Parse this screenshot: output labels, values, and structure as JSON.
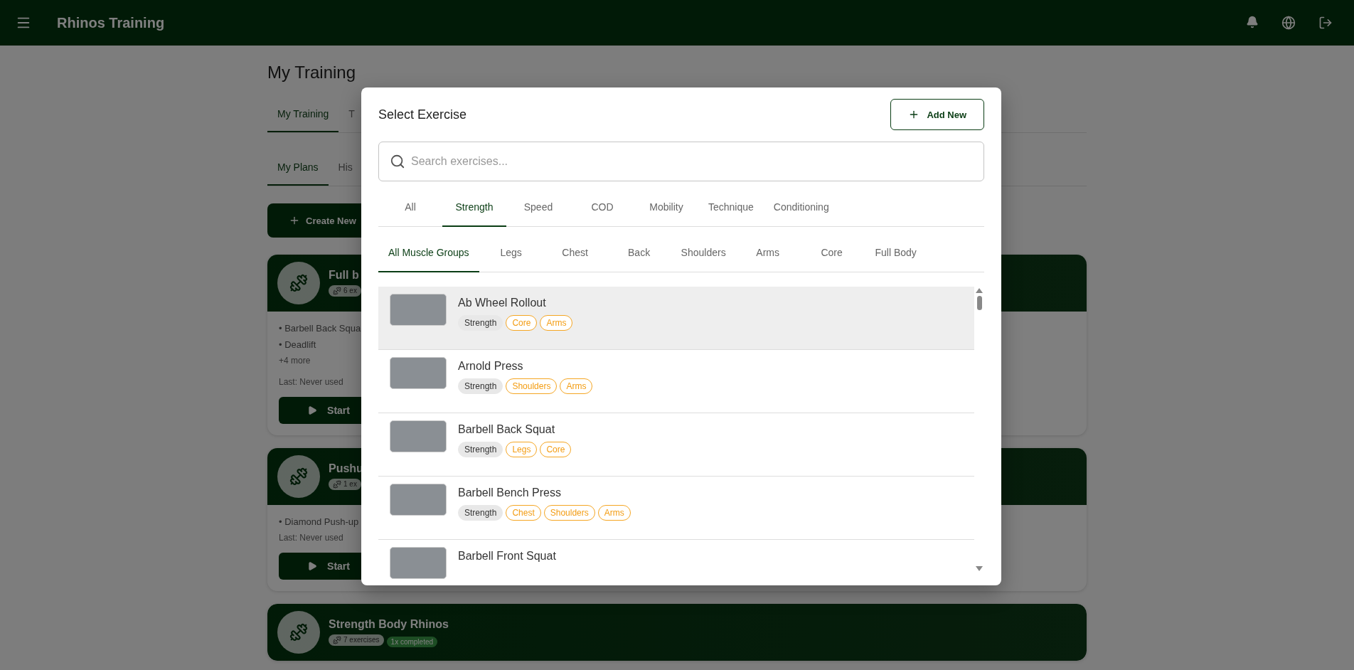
{
  "app_bar": {
    "title": "Rhinos Training"
  },
  "page": {
    "title": "My Training",
    "tabs": [
      {
        "label": "My Training",
        "selected": true
      },
      {
        "label": "T",
        "selected": false
      }
    ],
    "sub_tabs": [
      {
        "label": "My Plans",
        "selected": true
      },
      {
        "label": "His",
        "selected": false
      }
    ],
    "create_button": "Create New",
    "plans": [
      {
        "title": "Full b",
        "exercise_count": "6 ex",
        "items": [
          "• Barbell Back Squa",
          "• Deadlift"
        ],
        "more": "+4 more",
        "last_used": "Last: Never used",
        "start": "Start"
      },
      {
        "title": "Pushu",
        "exercise_count": "1 ex",
        "items": [
          "• Diamond Push-up"
        ],
        "last_used": "Last: Never used",
        "start": "Start"
      },
      {
        "title": "Strength Body Rhinos",
        "exercise_count": "7 exercises",
        "completed": "1x completed"
      }
    ]
  },
  "dialog": {
    "title": "Select Exercise",
    "add_button": "Add New",
    "search": {
      "placeholder": "Search exercises..."
    },
    "category_tabs": [
      {
        "label": "All",
        "selected": false
      },
      {
        "label": "Strength",
        "selected": true
      },
      {
        "label": "Speed",
        "selected": false
      },
      {
        "label": "COD",
        "selected": false
      },
      {
        "label": "Mobility",
        "selected": false
      },
      {
        "label": "Technique",
        "selected": false
      },
      {
        "label": "Conditioning",
        "selected": false
      }
    ],
    "muscle_tabs": [
      {
        "label": "All Muscle Groups",
        "selected": true
      },
      {
        "label": "Legs",
        "selected": false
      },
      {
        "label": "Chest",
        "selected": false
      },
      {
        "label": "Back",
        "selected": false
      },
      {
        "label": "Shoulders",
        "selected": false
      },
      {
        "label": "Arms",
        "selected": false
      },
      {
        "label": "Core",
        "selected": false
      },
      {
        "label": "Full Body",
        "selected": false
      }
    ],
    "exercises": [
      {
        "name": "Ab Wheel Rollout",
        "selected": true,
        "tags": [
          {
            "label": "Strength",
            "kind": "category"
          },
          {
            "label": "Core",
            "kind": "muscle"
          },
          {
            "label": "Arms",
            "kind": "muscle"
          }
        ]
      },
      {
        "name": "Arnold Press",
        "selected": false,
        "tags": [
          {
            "label": "Strength",
            "kind": "category"
          },
          {
            "label": "Shoulders",
            "kind": "muscle"
          },
          {
            "label": "Arms",
            "kind": "muscle"
          }
        ]
      },
      {
        "name": "Barbell Back Squat",
        "selected": false,
        "tags": [
          {
            "label": "Strength",
            "kind": "category"
          },
          {
            "label": "Legs",
            "kind": "muscle"
          },
          {
            "label": "Core",
            "kind": "muscle"
          }
        ]
      },
      {
        "name": "Barbell Bench Press",
        "selected": false,
        "tags": [
          {
            "label": "Strength",
            "kind": "category"
          },
          {
            "label": "Chest",
            "kind": "muscle"
          },
          {
            "label": "Shoulders",
            "kind": "muscle"
          },
          {
            "label": "Arms",
            "kind": "muscle"
          }
        ]
      },
      {
        "name": "Barbell Front Squat",
        "selected": false
      }
    ]
  }
}
